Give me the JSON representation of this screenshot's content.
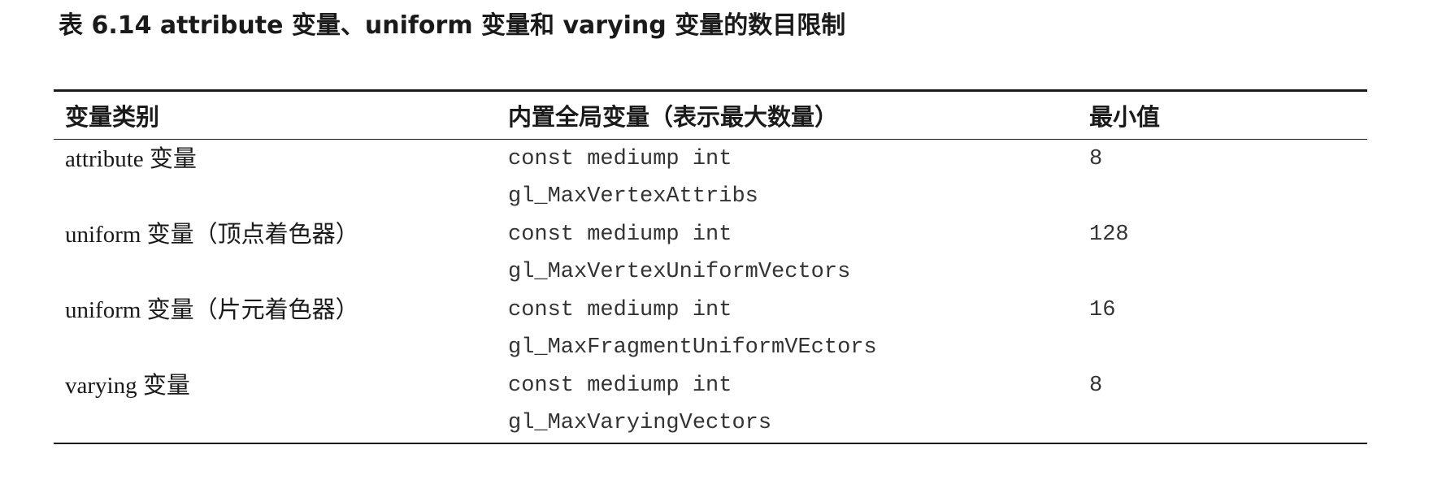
{
  "caption": "表 6.14  attribute 变量、uniform 变量和 varying 变量的数目限制",
  "table": {
    "headers": [
      "变量类别",
      "内置全局变量（表示最大数量）",
      "最小值"
    ],
    "rows": [
      {
        "category": "attribute 变量",
        "builtin_line1": "const mediump int",
        "builtin_line2": "gl_MaxVertexAttribs",
        "min_value": "8"
      },
      {
        "category": "uniform 变量（顶点着色器）",
        "builtin_line1": "const mediump int",
        "builtin_line2": "gl_MaxVertexUniformVectors",
        "min_value": "128"
      },
      {
        "category": "uniform 变量（片元着色器）",
        "builtin_line1": "const mediump int",
        "builtin_line2": "gl_MaxFragmentUniformVEctors",
        "min_value": "16"
      },
      {
        "category": "varying 变量",
        "builtin_line1": "const mediump int",
        "builtin_line2": "gl_MaxVaryingVectors",
        "min_value": "8"
      }
    ]
  }
}
